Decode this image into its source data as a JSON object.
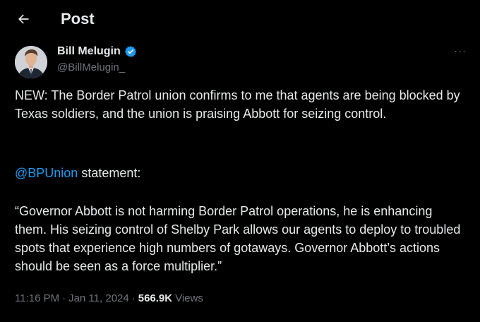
{
  "header": {
    "title": "Post",
    "back_icon": "back-arrow-icon"
  },
  "author": {
    "name": "Bill Melugin",
    "handle": "@BillMelugin_",
    "verified_icon": "verified-badge-icon",
    "verified_color": "#1d9bf0"
  },
  "more_icon": "more-options-icon",
  "post": {
    "paragraph1": "NEW: The Border Patrol union confirms to me that agents are being blocked by Texas soldiers, and the union is praising Abbott for seizing control.",
    "mention": "@BPUnion",
    "paragraph2_rest": " statement:",
    "paragraph3": "“Governor Abbott is not harming Border Patrol operations, he is enhancing them. His seizing control of Shelby Park allows our agents to deploy to troubled spots that experience high numbers of gotaways. Governor Abbott’s actions should be seen as a force multiplier.”"
  },
  "meta": {
    "time": "11:16 PM",
    "separator": "·",
    "date": "Jan 11, 2024",
    "views_count": "566.9K",
    "views_label": "Views"
  },
  "colors": {
    "background": "#000000",
    "text": "#e7e9ea",
    "muted": "#71767b",
    "link": "#1d9bf0"
  }
}
